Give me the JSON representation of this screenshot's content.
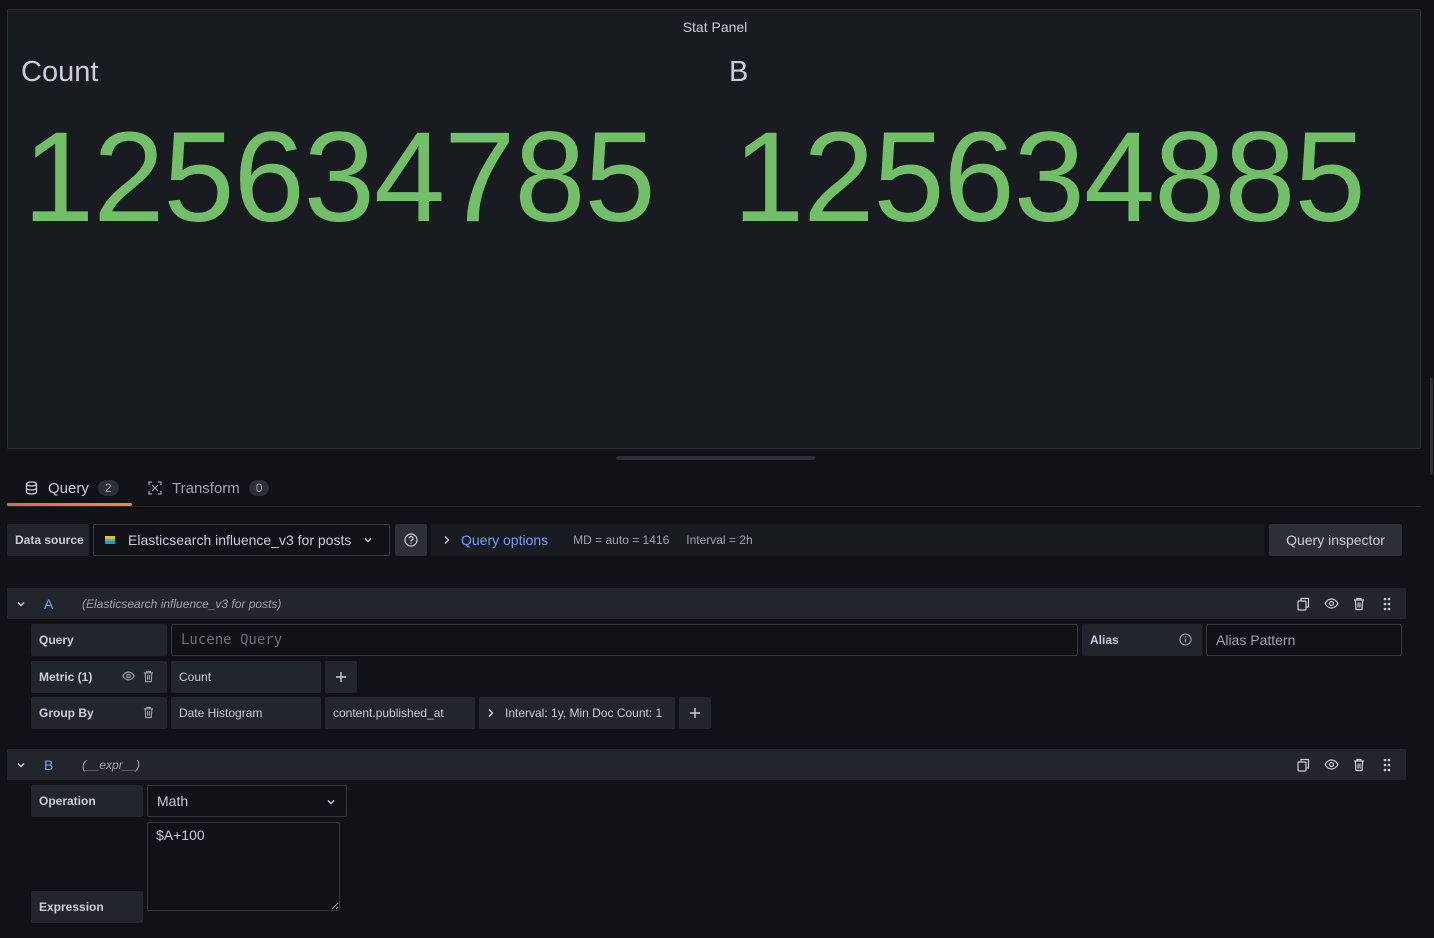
{
  "panel": {
    "title": "Stat Panel",
    "stats": [
      {
        "label": "Count",
        "value": "125634785"
      },
      {
        "label": "B",
        "value": "125634885"
      }
    ],
    "value_color": "#73bf69"
  },
  "tabs": [
    {
      "label": "Query",
      "count": "2",
      "icon": "database-icon",
      "active": true
    },
    {
      "label": "Transform",
      "count": "0",
      "icon": "transform-icon",
      "active": false
    }
  ],
  "datasource": {
    "label": "Data source",
    "selected": "Elasticsearch influence_v3 for posts",
    "help_icon": "question-circle-icon",
    "query_options_label": "Query options",
    "md": "MD = auto = 1416",
    "interval": "Interval = 2h",
    "inspector_label": "Query inspector"
  },
  "queries": {
    "a": {
      "ref": "A",
      "ds": "(Elasticsearch influence_v3 for posts)",
      "query_label": "Query",
      "query_placeholder": "Lucene Query",
      "alias_label": "Alias",
      "alias_placeholder": "Alias Pattern",
      "metric_label": "Metric (1)",
      "metric_value": "Count",
      "groupby_label": "Group By",
      "groupby_type": "Date Histogram",
      "groupby_field": "content.published_at",
      "groupby_settings": "Interval: 1y, Min Doc Count: 1"
    },
    "b": {
      "ref": "B",
      "ds": "(__expr__)",
      "operation_label": "Operation",
      "operation_value": "Math",
      "expression_label": "Expression",
      "expression_value": "$A+100"
    }
  },
  "colors": {
    "accent": "#6e9fff",
    "tab_active": "#f55f3e",
    "background": "#111217",
    "panel": "#181b1f"
  }
}
